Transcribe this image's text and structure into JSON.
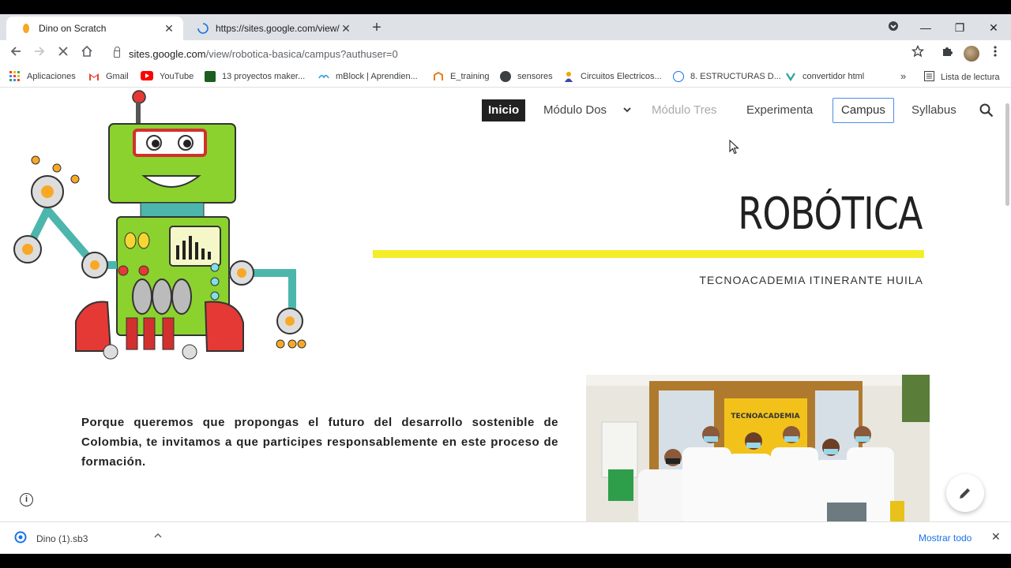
{
  "browser": {
    "tabs": [
      {
        "title": "Dino on Scratch",
        "active": true
      },
      {
        "title": "https://sites.google.com/view/rá",
        "active": false
      }
    ],
    "new_tab": "+",
    "window": {
      "minimize": "—",
      "restore": "❐",
      "close": "✕"
    },
    "url": {
      "host": "sites.google.com",
      "path": "/view/robotica-basica/campus?authuser=0"
    },
    "bookmarks": [
      {
        "label": "Aplicaciones",
        "icon": "apps-grid-icon"
      },
      {
        "label": "Gmail",
        "icon": "gmail-icon"
      },
      {
        "label": "YouTube",
        "icon": "youtube-icon"
      },
      {
        "label": "13 proyectos maker...",
        "icon": "bookmark-icon"
      },
      {
        "label": "mBlock | Aprendien...",
        "icon": "mblock-icon"
      },
      {
        "label": "E_training",
        "icon": "etraining-icon"
      },
      {
        "label": "sensores",
        "icon": "globe-icon"
      },
      {
        "label": "Circuitos Electricos...",
        "icon": "person-icon"
      },
      {
        "label": "8. ESTRUCTURAS D...",
        "icon": "unesco-icon"
      },
      {
        "label": "convertidor html",
        "icon": "converter-icon"
      }
    ],
    "bookmarks_more": "»",
    "reading_list": "Lista de lectura"
  },
  "site": {
    "nav": [
      {
        "label": "Inicio"
      },
      {
        "label": "Módulo Dos"
      },
      {
        "label": "Módulo Tres"
      },
      {
        "label": "Experimenta"
      },
      {
        "label": "Campus"
      },
      {
        "label": "Syllabus"
      }
    ],
    "hero_title": "ROBÓTICA",
    "hero_subtitle": "TECNOACADEMIA ITINERANTE HUILA",
    "intro": "Porque queremos que propongas el futuro del desarrollo sostenible de Colombia, te invitamos a que participes responsablemente en este proceso de formación.",
    "photo_sign": "TECNOACADEMIA",
    "accent_color": "#f4ed2a"
  },
  "download": {
    "file": "Dino (1).sb3",
    "show_all": "Mostrar todo"
  }
}
